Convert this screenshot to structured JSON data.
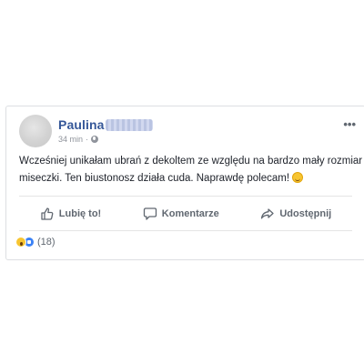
{
  "post": {
    "author": "Paulina",
    "time": "34 min",
    "separator": "·",
    "privacy_icon": "globe-icon",
    "more_label": "•••",
    "text_line1": "Wcześniej unikałam ubrań z dekoltem ze względu na bardzo mały rozmiar",
    "text_line2": "miseczki. Ten biustonosz działa cuda. Naprawdę polecam!",
    "emoji_icon": "rolling-on-floor-laughing-emoji"
  },
  "actions": {
    "like_label": "Lubię to!",
    "comment_label": "Komentarze",
    "share_label": "Udostępnij"
  },
  "reactions": {
    "icons": [
      "wow-reaction-icon",
      "like-reaction-icon"
    ],
    "count_label": "(18)"
  },
  "colors": {
    "author_link": "#365899",
    "meta_gray": "#90949c",
    "action_gray": "#606770",
    "text": "#1d2129",
    "border": "#dddfe2"
  }
}
